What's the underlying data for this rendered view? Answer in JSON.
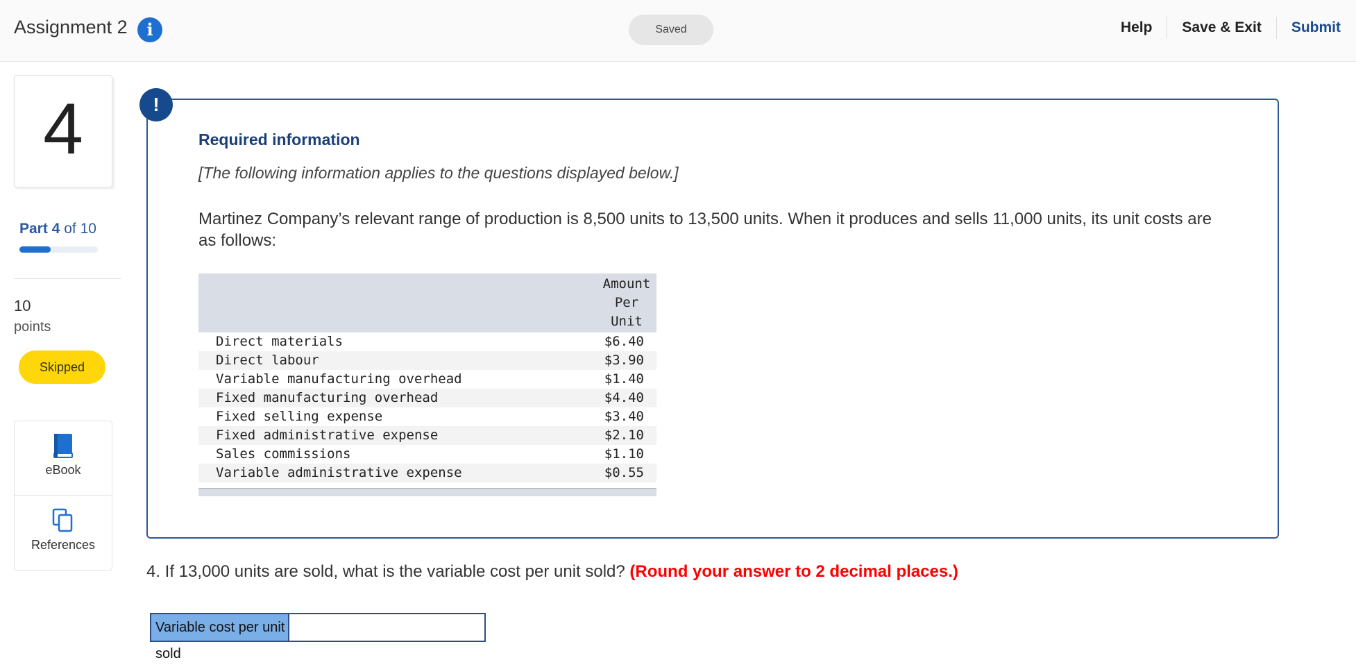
{
  "header": {
    "title": "Assignment 2",
    "info_glyph": "i",
    "saved_label": "Saved",
    "help_label": "Help",
    "save_exit_label": "Save & Exit",
    "submit_label": "Submit"
  },
  "sidebar": {
    "question_number": "4",
    "part_prefix": "Part",
    "part_current": "4",
    "part_suffix": "of 10",
    "progress_fraction": 0.4,
    "points_value": "10",
    "points_label": "points",
    "status_badge": "Skipped",
    "ebook_label": "eBook",
    "references_label": "References"
  },
  "required_info": {
    "alert_glyph": "!",
    "heading": "Required information",
    "note": "[The following information applies to the questions displayed below.]",
    "paragraph": "Martinez Company’s relevant range of production is 8,500 units to 13,500 units. When it produces and sells 11,000 units, its unit costs are as follows:",
    "table": {
      "header_amount": "Amount Per Unit",
      "rows": [
        {
          "item": "Direct materials",
          "amount": "$6.40"
        },
        {
          "item": "Direct labour",
          "amount": "$3.90"
        },
        {
          "item": "Variable manufacturing overhead",
          "amount": "$1.40"
        },
        {
          "item": "Fixed manufacturing overhead",
          "amount": "$4.40"
        },
        {
          "item": "Fixed selling expense",
          "amount": "$3.40"
        },
        {
          "item": "Fixed administrative expense",
          "amount": "$2.10"
        },
        {
          "item": "Sales commissions",
          "amount": "$1.10"
        },
        {
          "item": "Variable administrative expense",
          "amount": "$0.55"
        }
      ]
    }
  },
  "question": {
    "text": "4. If 13,000 units are sold, what is the variable cost per unit sold?",
    "instruction": "(Round your answer to 2 decimal places.)",
    "answer_label": "Variable cost per unit sold",
    "answer_value": ""
  },
  "colors": {
    "accent": "#1f6fd1",
    "box_border": "#2b5797",
    "badge_yellow": "#ffd60a",
    "instruction_red": "#ff0000",
    "answer_label_bg": "#7aaee6"
  },
  "icons": {
    "info": "info-icon",
    "alert": "alert-icon",
    "ebook": "book-icon",
    "references": "copy-pages-icon"
  }
}
